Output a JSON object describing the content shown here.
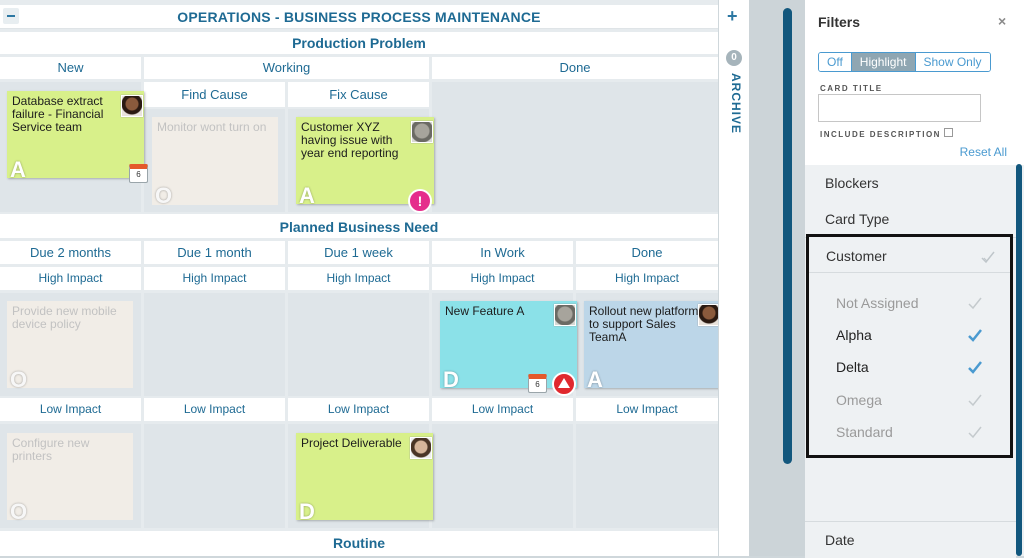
{
  "board": {
    "title": "OPERATIONS - BUSINESS PROCESS MAINTENANCE",
    "lanes": {
      "production": "Production Problem",
      "planned": "Planned Business Need",
      "routine": "Routine"
    },
    "production_cols": {
      "new": "New",
      "working": "Working",
      "done": "Done",
      "find_cause": "Find Cause",
      "fix_cause": "Fix Cause"
    },
    "planned_cols": [
      "Due 2 months",
      "Due 1 month",
      "Due 1 week",
      "In Work",
      "Done"
    ],
    "high_impact": "High Impact",
    "low_impact": "Low Impact",
    "cards": {
      "c1": {
        "text": "Database extract failure - Financial Service team",
        "letter": "A",
        "date": "6"
      },
      "c2": {
        "text": "Monitor wont turn on",
        "letter": "O"
      },
      "c3": {
        "text": "Customer XYZ having issue with year end reporting",
        "letter": "A",
        "blocker": "!"
      },
      "c4": {
        "text": "Provide new mobile device policy",
        "letter": "O"
      },
      "c5": {
        "text": "New Feature A",
        "letter": "D",
        "date": "6"
      },
      "c6": {
        "text": "Rollout new platform to support Sales TeamA",
        "letter": "A"
      },
      "c7": {
        "text": "Configure new printers",
        "letter": "O"
      },
      "c8": {
        "text": "Project Deliverable",
        "letter": "D"
      }
    }
  },
  "archive": {
    "count": "0",
    "label": "ARCHIVE",
    "plus": "+"
  },
  "filters": {
    "title": "Filters",
    "close": "×",
    "modes": {
      "off": "Off",
      "highlight": "Highlight",
      "show_only": "Show Only"
    },
    "card_title_label": "CARD TITLE",
    "include_description_label": "INCLUDE DESCRIPTION",
    "reset": "Reset All",
    "sections": {
      "blockers": "Blockers",
      "card_type": "Card Type",
      "customer": "Customer",
      "date": "Date"
    },
    "customer_options": [
      {
        "label": "Not Assigned",
        "checked": false
      },
      {
        "label": "Alpha",
        "checked": true
      },
      {
        "label": "Delta",
        "checked": true
      },
      {
        "label": "Omega",
        "checked": false
      },
      {
        "label": "Standard",
        "checked": false
      }
    ]
  },
  "colors": {
    "accent": "#1e6a93",
    "card_green": "#d8f08a",
    "card_blue": "#8be1e8",
    "card_lightblue": "#bcd6e8",
    "blocker": "#e52e8c",
    "priority": "#e0292e"
  },
  "icons": [
    "collapse-icon",
    "calendar-icon",
    "blocker-icon",
    "priority-icon",
    "plus-icon",
    "close-icon",
    "checkmark-icon",
    "avatar-icon"
  ]
}
